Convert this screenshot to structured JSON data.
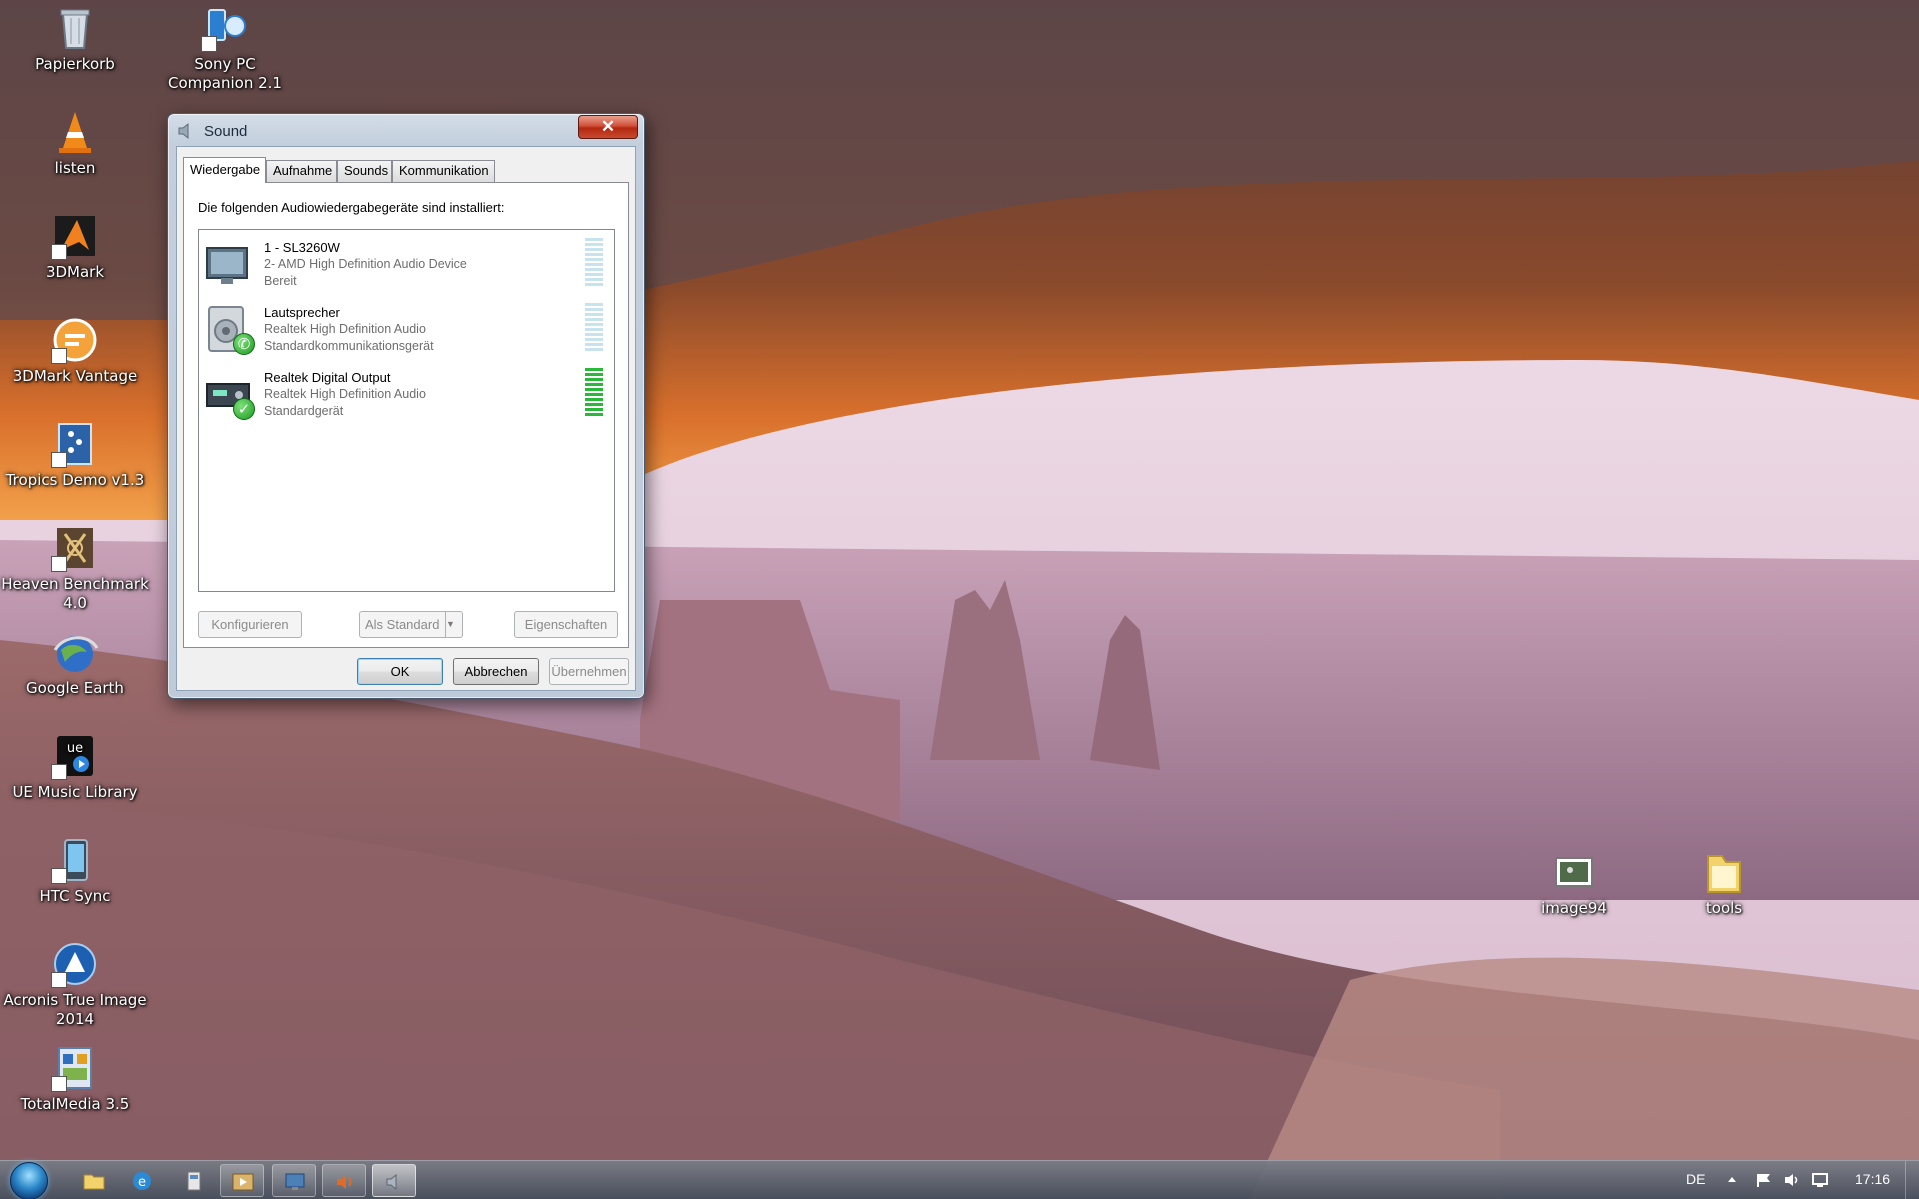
{
  "desktop": {
    "icons_left": [
      {
        "label": "Papierkorb",
        "icon": "recycle-bin-icon"
      },
      {
        "label": "listen",
        "icon": "vlc-cone-icon"
      },
      {
        "label": "3DMark",
        "icon": "3dmark-icon"
      },
      {
        "label": "3DMark Vantage",
        "icon": "3dmark-vantage-icon"
      },
      {
        "label": "Tropics Demo v1.3",
        "icon": "tropics-demo-icon"
      },
      {
        "label": "Heaven Benchmark 4.0",
        "icon": "heaven-benchmark-icon"
      },
      {
        "label": "Google Earth",
        "icon": "google-earth-icon"
      },
      {
        "label": "UE Music Library",
        "icon": "ue-music-icon"
      },
      {
        "label": "HTC Sync",
        "icon": "htc-sync-icon"
      },
      {
        "label": "Acronis True Image 2014",
        "icon": "acronis-icon"
      },
      {
        "label": "TotalMedia 3.5",
        "icon": "totalmedia-icon"
      }
    ],
    "icon_sony": {
      "label": "Sony PC Companion 2.1",
      "icon": "sony-companion-icon"
    },
    "icon_image94": {
      "label": "image94",
      "icon": "image-file-icon"
    },
    "icon_tools": {
      "label": "tools",
      "icon": "folder-icon"
    }
  },
  "dialog": {
    "title": "Sound",
    "close_label": "✕",
    "tabs": [
      "Wiedergabe",
      "Aufnahme",
      "Sounds",
      "Kommunikation"
    ],
    "active_tab": "Wiedergabe",
    "intro": "Die folgenden Audiowiedergabegeräte sind installiert:",
    "devices": [
      {
        "name": "1 - SL3260W",
        "driver": "2- AMD High Definition Audio Device",
        "status": "Bereit",
        "icon": "monitor-icon",
        "default_badge": false,
        "level_active": false
      },
      {
        "name": "Lautsprecher",
        "driver": "Realtek High Definition Audio",
        "status": "Standardkommunikationsgerät",
        "icon": "speaker-icon",
        "default_badge": true,
        "level_active": false
      },
      {
        "name": "Realtek Digital Output",
        "driver": "Realtek High Definition Audio",
        "status": "Standardgerät",
        "icon": "digital-output-icon",
        "default_badge": true,
        "level_active": true
      }
    ],
    "buttons": {
      "configure": "Konfigurieren",
      "set_default": "Als Standard",
      "properties": "Eigenschaften",
      "ok": "OK",
      "cancel": "Abbrechen",
      "apply": "Übernehmen"
    }
  },
  "taskbar": {
    "items": [
      "explorer-icon",
      "internet-explorer-icon",
      "app-icon",
      "media-icon",
      "remote-desktop-icon",
      "speaker-app-icon",
      "sound-dialog-icon"
    ],
    "language": "DE",
    "clock": "17:16"
  }
}
